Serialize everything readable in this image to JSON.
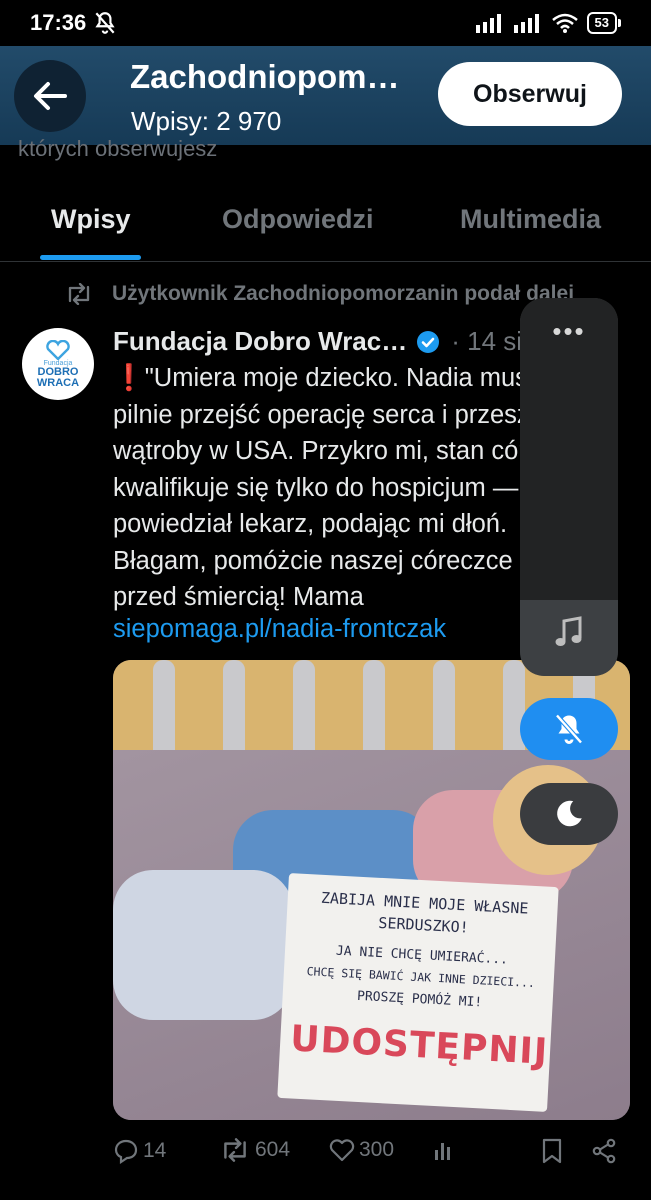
{
  "status_bar": {
    "time": "17:36",
    "battery": "53",
    "icons": [
      "bell-muted-icon",
      "signal-icon",
      "signal-icon",
      "wifi-icon",
      "battery-icon"
    ]
  },
  "header": {
    "title": "Zachodniopom…",
    "subtitle": "Wpisy: 2 970",
    "follow_label": "Obserwuj",
    "back_icon": "arrow-left-icon"
  },
  "ghost_text": "których obserwujesz",
  "tabs": [
    {
      "label": "Wpisy",
      "active": true
    },
    {
      "label": "Odpowiedzi",
      "active": false
    },
    {
      "label": "Multimedia",
      "active": false
    }
  ],
  "repost": {
    "text": "Użytkownik Zachodniopomorzanin podał dalej",
    "icon": "repost-icon"
  },
  "tweet": {
    "avatar_text_small": "Fundacja",
    "avatar_text_1": "DOBRO",
    "avatar_text_2": "WRACA",
    "author_name": "Fundacja Dobro Wrac…",
    "verified_icon": "verified-badge-icon",
    "meta": "· 14 sie",
    "text": "❗\"Umiera moje dziecko. Nadia musi\npilnie przejść operację serca i przeszczep\nwątroby w USA. Przykro mi, stan córki\nkwalifikuje się tylko do hospicjum —\npowiedział lekarz, podając mi dłoń.\nBłagam, pomóżcie naszej córeczce uciec\nprzed śmiercią! Mama",
    "link": "siepomaga.pl/nadia-frontczak",
    "image": {
      "sign_lines": [
        "ZABIJA MNIE MOJE WŁASNE",
        "SERDUSZKO!",
        "JA NIE CHCĘ UMIERAĆ...",
        "CHCĘ SIĘ BAWIĆ JAK INNE DZIECI...",
        "PROSZĘ POMÓŻ MI!"
      ],
      "sign_big": "UDOSTĘPNIJ"
    },
    "actions": {
      "replies": "14",
      "reposts": "604",
      "likes": "300"
    }
  },
  "overlay": {
    "more": "•••",
    "icons": [
      "music-note-icon",
      "bell-off-icon",
      "moon-icon"
    ]
  }
}
